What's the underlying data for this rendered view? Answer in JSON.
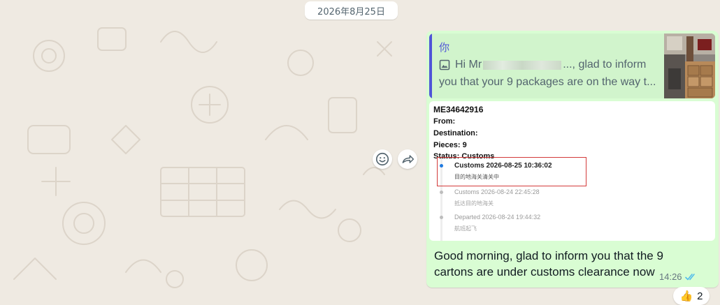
{
  "date_chip": "2026年8月25日",
  "actions": {
    "react_icon": "emoji-icon",
    "forward_icon": "forward-icon"
  },
  "message": {
    "quote": {
      "author": "你",
      "line1_prefix": "Hi Mr",
      "line1_suffix": "..., glad to inform",
      "line2": "you that your 9 packages are on the way t...",
      "image_icon": "image-icon",
      "thumbnail": "warehouse-packages-photo"
    },
    "tracking": {
      "number": "ME34642916",
      "from_label": "From:",
      "destination_label": "Destination:",
      "pieces_label": "Pieces: 9",
      "status_label": "Status: Customs",
      "events": [
        {
          "title": "Customs 2026-08-25 10:36:02",
          "detail": "目的地海关清关中",
          "active": true
        },
        {
          "title": "Customs 2026-08-24 22:45:28",
          "detail": "抵达目的地海关",
          "active": false
        },
        {
          "title": "Departed 2026-08-24 19:44:32",
          "detail": "航班起飞",
          "active": false
        }
      ]
    },
    "body": "Good morning, glad to inform you that the 9 cartons are under customs clearance now",
    "time": "14:26",
    "status_icon": "double-check-icon"
  },
  "reaction": {
    "emoji": "👍",
    "count": "2"
  },
  "colors": {
    "chat_bg": "#efeae2",
    "bubble": "#d9fdd3",
    "quote_accent": "#5055d8",
    "read_ticks": "#53bdeb",
    "highlight_box": "#d33a3a"
  }
}
